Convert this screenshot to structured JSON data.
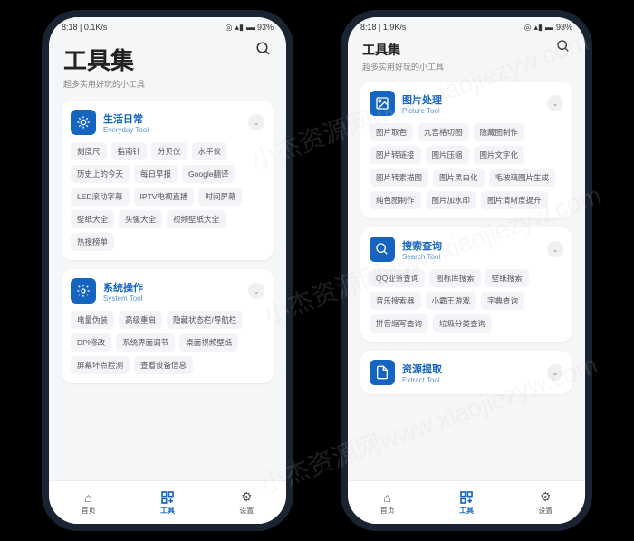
{
  "watermark": "小杰资源网www.xiaojiezyw.com",
  "status": {
    "left_a": "8:18 | 0.1K/s",
    "left_b": "8:18 | 1.9K/s",
    "battery": "93%"
  },
  "header": {
    "title": "工具集",
    "subtitle": "超多实用好玩的小工具"
  },
  "phone_left": {
    "sections": [
      {
        "icon": "sun",
        "title_cn": "生活日常",
        "title_en": "Everyday Tool",
        "tags": [
          "刻度尺",
          "指南针",
          "分贝仪",
          "水平仪",
          "历史上的今天",
          "每日早报",
          "Google翻译",
          "LED滚动字幕",
          "IPTV电视直播",
          "时间屏幕",
          "壁纸大全",
          "头像大全",
          "视频壁纸大全",
          "热搜榜单"
        ]
      },
      {
        "icon": "gear",
        "title_cn": "系统操作",
        "title_en": "System Tool",
        "tags": [
          "电量伪装",
          "高级重启",
          "隐藏状态栏/导航栏",
          "DPI修改",
          "系统界面调节",
          "桌面视频壁纸",
          "屏幕坏点检测",
          "查看设备信息"
        ]
      }
    ]
  },
  "phone_right": {
    "sections": [
      {
        "icon": "image",
        "title_cn": "图片处理",
        "title_en": "Picture Tool",
        "tags": [
          "图片取色",
          "九宫格切图",
          "隐藏图制作",
          "图片转链接",
          "图片压缩",
          "图片文字化",
          "图片转素描图",
          "图片黑白化",
          "毛玻璃图片生成",
          "纯色图制作",
          "图片加水印",
          "图片清晰度提升"
        ]
      },
      {
        "icon": "search",
        "title_cn": "搜索查询",
        "title_en": "Search Tool",
        "tags": [
          "QQ业务查询",
          "图标库搜索",
          "壁纸搜索",
          "音乐搜索器",
          "小霸王游戏",
          "字典查询",
          "拼音缩写查询",
          "垃圾分类查询"
        ]
      },
      {
        "icon": "file",
        "title_cn": "资源提取",
        "title_en": "Extract Tool",
        "tags": []
      }
    ]
  },
  "nav": {
    "items": [
      {
        "label": "首页"
      },
      {
        "label": "工具"
      },
      {
        "label": "设置"
      }
    ]
  }
}
